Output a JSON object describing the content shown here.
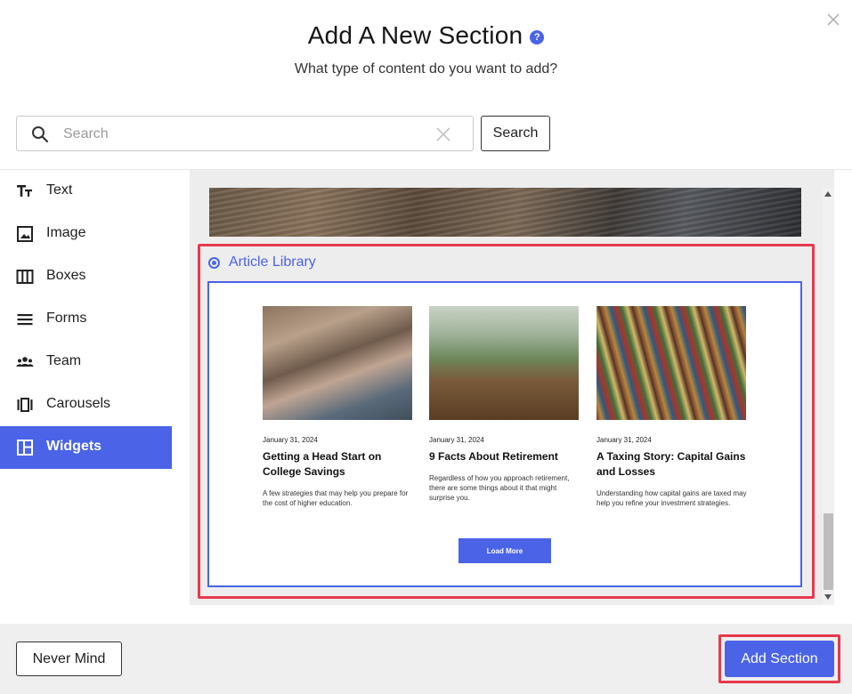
{
  "header": {
    "title": "Add A New Section",
    "help_glyph": "?",
    "subtitle": "What type of content do you want to add?"
  },
  "search": {
    "placeholder": "Search",
    "value": "",
    "button_label": "Search"
  },
  "sidebar": {
    "items": [
      {
        "label": "Text",
        "icon": "text-icon",
        "active": false
      },
      {
        "label": "Image",
        "icon": "image-icon",
        "active": false
      },
      {
        "label": "Boxes",
        "icon": "boxes-icon",
        "active": false
      },
      {
        "label": "Forms",
        "icon": "forms-icon",
        "active": false
      },
      {
        "label": "Team",
        "icon": "team-icon",
        "active": false
      },
      {
        "label": "Carousels",
        "icon": "carousels-icon",
        "active": false
      },
      {
        "label": "Widgets",
        "icon": "widgets-icon",
        "active": true
      }
    ]
  },
  "option": {
    "label": "Article Library",
    "selected": true
  },
  "articles": [
    {
      "date": "January 31, 2024",
      "title": "Getting a Head Start on College Savings",
      "description": "A few strategies that may help you prepare for the cost of higher education."
    },
    {
      "date": "January 31, 2024",
      "title": "9 Facts About Retirement",
      "description": "Regardless of how you approach retirement, there are some things about it that might surprise you."
    },
    {
      "date": "January 31, 2024",
      "title": "A Taxing Story: Capital Gains and Losses",
      "description": "Understanding how capital gains are taxed may help you refine your investment strategies."
    }
  ],
  "load_more_label": "Load More",
  "footer": {
    "cancel_label": "Never Mind",
    "confirm_label": "Add Section"
  },
  "colors": {
    "accent": "#4a63e7",
    "highlight": "#e8394d"
  }
}
